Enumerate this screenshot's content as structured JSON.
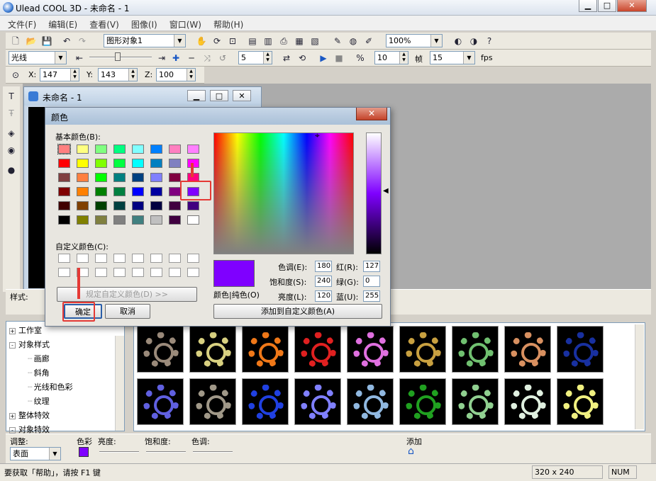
{
  "app": {
    "title": "Ulead COOL 3D - 未命名 - 1"
  },
  "menu": [
    "文件(F)",
    "编辑(E)",
    "查看(V)",
    "图像(I)",
    "窗口(W)",
    "帮助(H)"
  ],
  "toolbar1": {
    "object_combo": "图形对象1",
    "zoom_combo": "100%"
  },
  "toolbar2": {
    "light_combo": "光线",
    "frame_step": "5",
    "frame_current": "10",
    "frame_label": "帧",
    "fps_value": "15",
    "fps_label": "fps"
  },
  "toolbar3": {
    "x_label": "X:",
    "x_value": "147",
    "y_label": "Y:",
    "y_value": "143",
    "z_label": "Z:",
    "z_value": "100"
  },
  "child_window": {
    "title": "未命名 - 1"
  },
  "style_bar": {
    "label": "样式:"
  },
  "dialog": {
    "title": "颜色",
    "basic_colors_label": "基本颜色(B):",
    "custom_colors_label": "自定义颜色(C):",
    "define_custom_button": "规定自定义颜色(D) >>",
    "ok_button": "确定",
    "cancel_button": "取消",
    "color_solid_label": "颜色|纯色(O)",
    "hue_label": "色调(E):",
    "hue_value": "180",
    "sat_label": "饱和度(S):",
    "sat_value": "240",
    "lum_label": "亮度(L):",
    "lum_value": "120",
    "red_label": "红(R):",
    "red_value": "127",
    "green_label": "绿(G):",
    "green_value": "0",
    "blue_label": "蓝(U):",
    "blue_value": "255",
    "add_custom_button": "添加到自定义颜色(A)",
    "selected_color": "#7f00ff",
    "basic_colors": [
      [
        "#ff8080",
        "#ffff80",
        "#80ff80",
        "#00ff80",
        "#80ffff",
        "#0080ff",
        "#ff80c0",
        "#ff80ff"
      ],
      [
        "#ff0000",
        "#ffff00",
        "#80ff00",
        "#00ff40",
        "#00ffff",
        "#0080c0",
        "#8080c0",
        "#ff00ff"
      ],
      [
        "#804040",
        "#ff8040",
        "#00ff00",
        "#008080",
        "#004080",
        "#8080ff",
        "#800040",
        "#ff0080"
      ],
      [
        "#800000",
        "#ff8000",
        "#008000",
        "#008040",
        "#0000ff",
        "#0000a0",
        "#800080",
        "#8000ff"
      ],
      [
        "#400000",
        "#804000",
        "#004000",
        "#004040",
        "#000080",
        "#000040",
        "#400040",
        "#400080"
      ],
      [
        "#000000",
        "#808000",
        "#808040",
        "#808080",
        "#408080",
        "#c0c0c0",
        "#400040",
        "#ffffff"
      ]
    ]
  },
  "tree": [
    {
      "label": "工作室",
      "indent": 0,
      "expander": "+"
    },
    {
      "label": "对象样式",
      "indent": 0,
      "expander": "-"
    },
    {
      "label": "画廊",
      "indent": 1,
      "expander": ""
    },
    {
      "label": "斜角",
      "indent": 1,
      "expander": ""
    },
    {
      "label": "光线和色彩",
      "indent": 1,
      "expander": ""
    },
    {
      "label": "纹理",
      "indent": 1,
      "expander": ""
    },
    {
      "label": "整体特效",
      "indent": 0,
      "expander": "+"
    },
    {
      "label": "对象特效",
      "indent": 0,
      "expander": "-"
    }
  ],
  "gallery_colors": [
    "#9a8a7a",
    "#d8d080",
    "#f07818",
    "#e02020",
    "#e070e0",
    "#c8a040",
    "#70c070",
    "#d89060",
    "#1830a0",
    "#6060e0",
    "#a09888",
    "#2040e0",
    "#8080ff",
    "#90b8e0",
    "#20a020",
    "#90d090",
    "#e0f0e0",
    "#f0f080"
  ],
  "adjust": {
    "label": "调整:",
    "mode": "表面",
    "color_label": "色彩",
    "brightness_label": "亮度:",
    "saturation_label": "饱和度:",
    "hue_label": "色调:",
    "add_label": "添加",
    "color_value": "#7f00ff"
  },
  "status": {
    "help_text": "要获取「帮助」，请按 F1 键",
    "size": "320 x 240",
    "num": "NUM"
  },
  "colors": {
    "marker": "#e53935"
  }
}
